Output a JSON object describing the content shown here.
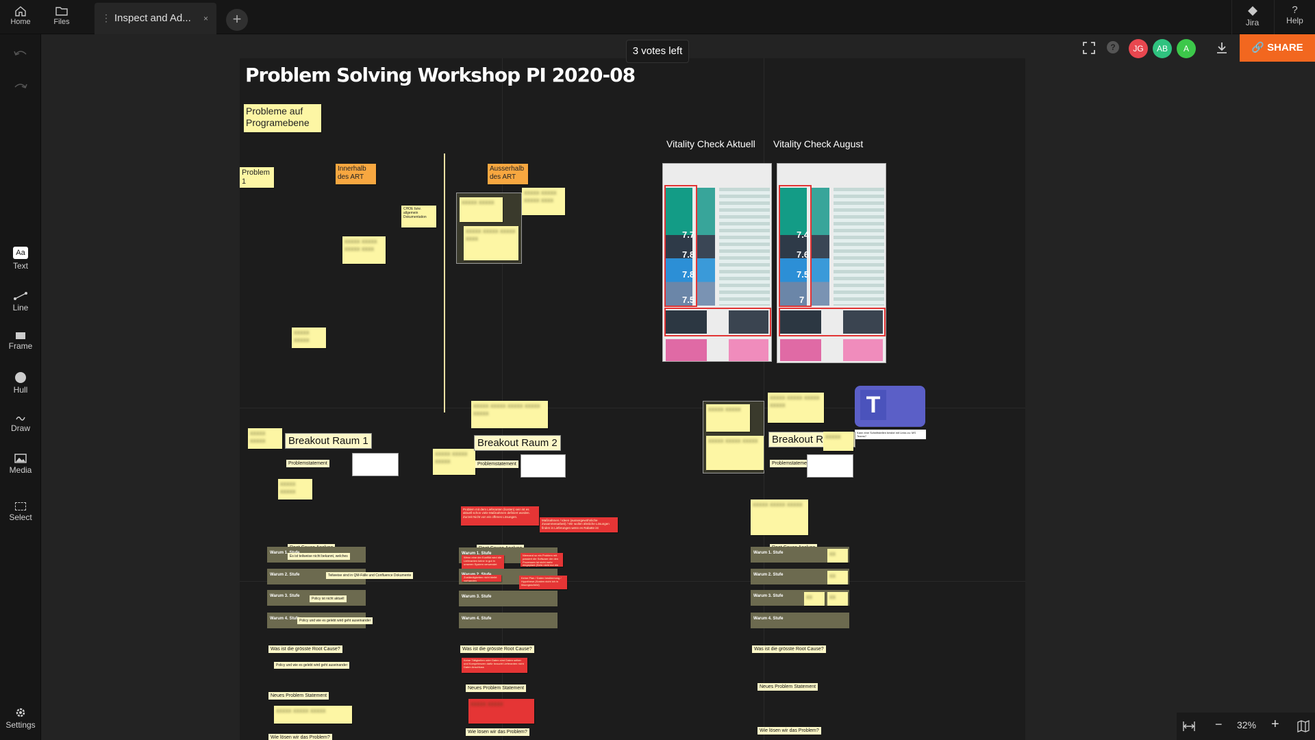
{
  "topbar": {
    "home_label": "Home",
    "files_label": "Files",
    "tab_title": "Inspect and Ad...",
    "tab_close": "×",
    "add_tab": "+",
    "jira_label": "Jira",
    "help_label": "Help",
    "help_glyph": "?"
  },
  "toolbar": {
    "text_label": "Text",
    "text_glyph": "Aa",
    "line_label": "Line",
    "frame_label": "Frame",
    "hull_label": "Hull",
    "draw_label": "Draw",
    "media_label": "Media",
    "select_label": "Select",
    "settings_label": "Settings"
  },
  "header_right": {
    "votes": "3 votes left",
    "avatars": [
      "JG",
      "AB",
      "A"
    ],
    "avatar_colors": [
      "#e8474f",
      "#2fc27f",
      "#3cc84a"
    ],
    "share_label": "SHARE",
    "accent": "#f2671f"
  },
  "zoom": {
    "level": "32%",
    "minus": "−",
    "plus": "+"
  },
  "board": {
    "title": "Problem Solving Workshop PI 2020-08",
    "probleme": "Probleme auf Programebene",
    "problem1": "Problem 1",
    "innerhalb": "Innerhalb des ART",
    "ausserhalb": "Ausserhalb des ART",
    "small_note": "CHOE bzw. allgemein Dokumentation",
    "vitality_aktuell": "Vitality Check Aktuell",
    "vitality_august": "Vitality Check August",
    "vitality_aktuell_values": [
      "7.7",
      "7.8",
      "7.8",
      "7.5"
    ],
    "vitality_august_values": [
      "7.4",
      "7.6",
      "7.5",
      "7"
    ],
    "breakout1": "Breakout Raum 1",
    "breakout2": "Breakout Raum 2",
    "breakout3": "Breakout Raum 3",
    "problemstatement": "Problemstatement",
    "root_cause": "Root Cause Analyse",
    "why1": "Warum 1. Stufe",
    "why2": "Warum 2. Stufe",
    "why3": "Warum 3. Stufe",
    "why4": "Warum 4. Stufe",
    "groesste": "Was ist die grösste Root Cause?",
    "neues": "Neues Problem Statement",
    "loesen": "Wie lösen wir das Problem?",
    "bubble_a": "Es ist teilweise nicht bekannt, welches",
    "bubble_b": "Teilweise sind in QM-Fälle und Confluence Dokumente",
    "bubble_c": "Policy ist nicht aktuell",
    "bubble_d": "Policy und wie es gelebt wird geht auseinander",
    "bubble_e": "Policy und wie es gelebt wird geht auseinander",
    "red1": "Problem mit dem Lieferanten (kosten) sein ist es aktuell schon viele Maßnahmen definiert worden. Zurzeit Nicht von ein offenes Lösungen.",
    "red2": "Maßnahmen / Ideen (aussergewöhnliche Zusammenarbeit) / Wir wollen ähnliche Lösungen finden in Lieferungen wenn es Rabatte ist",
    "red3": "Wenn eine der Konflikt wird die Lieferanten keine in gut in unseren System verwendet",
    "red4": "Niemand so ein Problem mit passiert die Software der den Prozessen ist nicht mehr eingeplant (Sehr nicht nur ein online)",
    "red5": "Zuständigkeiten nicht bleibt vorhanden",
    "red6": "Keine Plan / Daten bestimmung / Hypothese (Kosten nicht ich in lösungsscheid)",
    "red7": "Keine Tätigkeiten oder Daten sind Daten selber und Kompetenzen dafür braucht Lieferanten nicht Daten Anschluss",
    "teams_caption": "Kann eine Schnittstellen besitzt mit Links zu: MS Teams?"
  }
}
